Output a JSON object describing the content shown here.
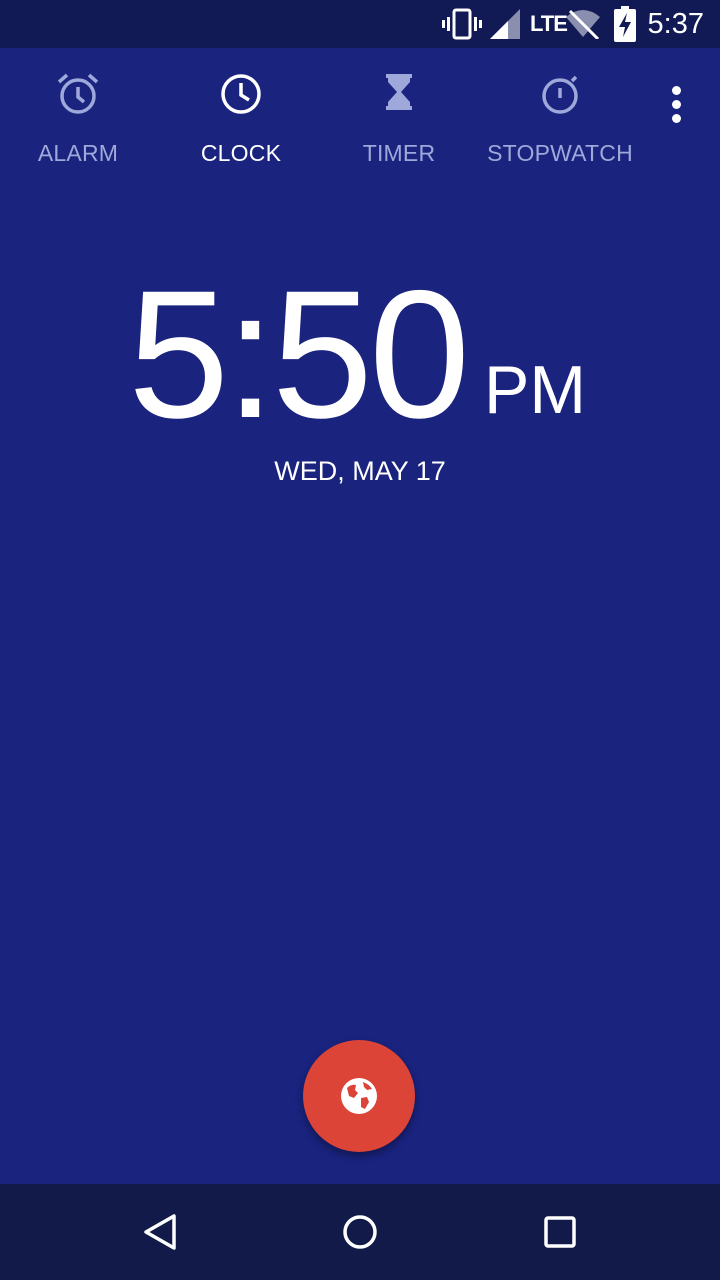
{
  "status_bar": {
    "time": "5:37",
    "icons": [
      "vibrate-icon",
      "signal-icon",
      "lte-icon",
      "wifi-off-icon",
      "battery-charging-icon"
    ],
    "lte_label": "LTE"
  },
  "tabs": [
    {
      "label": "ALARM",
      "icon": "alarm-icon",
      "active": false
    },
    {
      "label": "CLOCK",
      "icon": "clock-icon",
      "active": true
    },
    {
      "label": "TIMER",
      "icon": "hourglass-icon",
      "active": false
    },
    {
      "label": "STOPWATCH",
      "icon": "stopwatch-icon",
      "active": false
    }
  ],
  "clock": {
    "time": "5:50",
    "ampm": "PM",
    "date": "WED, MAY 17"
  },
  "fab": {
    "icon": "globe-icon"
  },
  "nav": {
    "icons": [
      "back-icon",
      "home-icon",
      "recents-icon"
    ]
  },
  "colors": {
    "background": "#1a237e",
    "status_bar": "#111a55",
    "fab": "#db4437",
    "inactive_tab": "#9fa8da",
    "active_tab": "#ffffff"
  }
}
